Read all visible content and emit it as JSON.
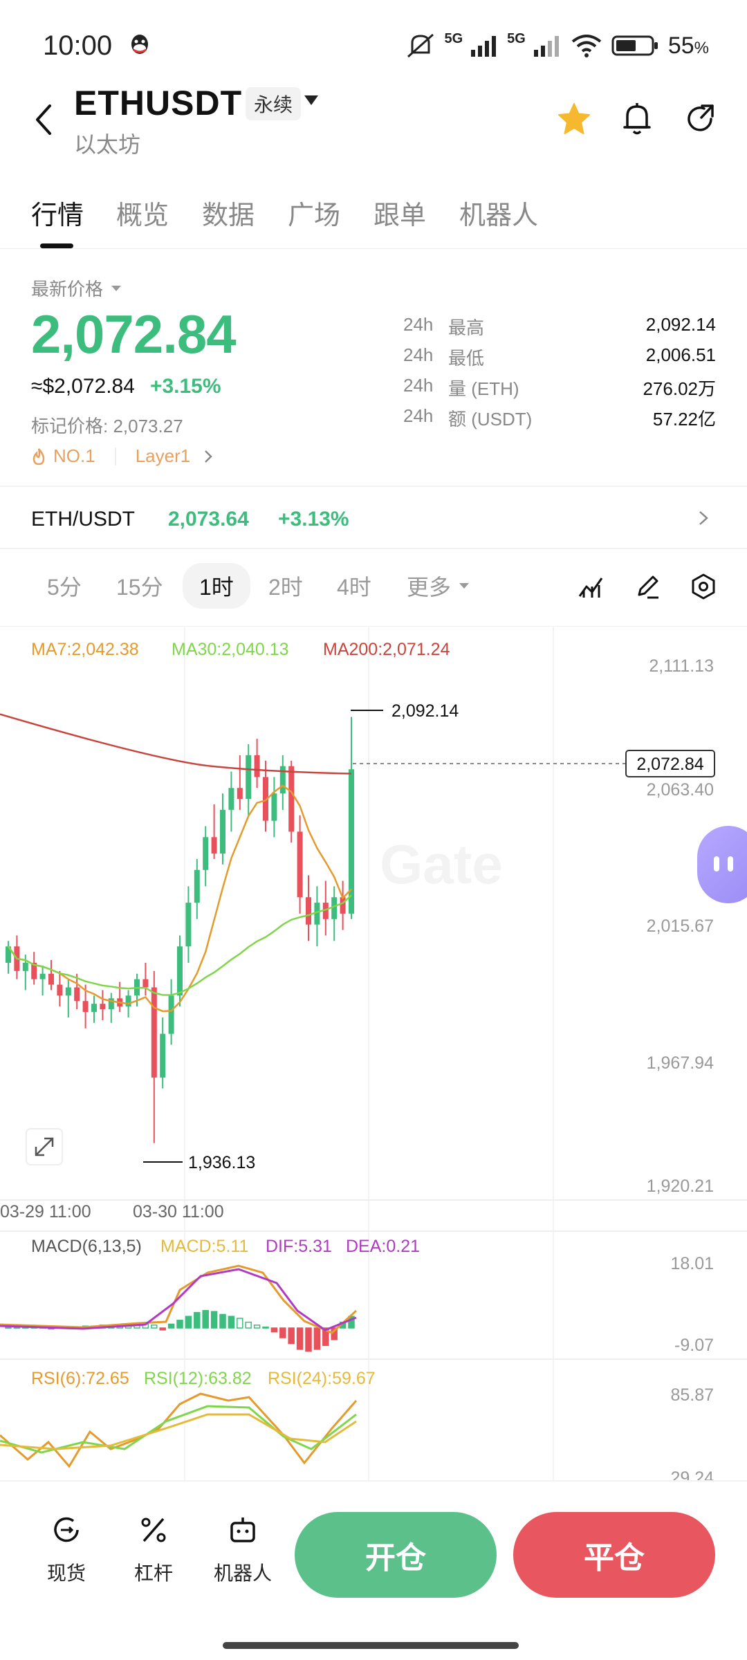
{
  "status_bar": {
    "time": "10:00",
    "signal1": "5G",
    "signal2": "5G",
    "battery": "55",
    "battery_unit": "%"
  },
  "header": {
    "symbol": "ETHUSDT",
    "contract_type": "永续",
    "name_cn": "以太坊"
  },
  "tabs": [
    {
      "label": "行情"
    },
    {
      "label": "概览"
    },
    {
      "label": "数据"
    },
    {
      "label": "广场"
    },
    {
      "label": "跟单"
    },
    {
      "label": "机器人"
    }
  ],
  "price": {
    "latest_label": "最新价格",
    "last": "2,072.84",
    "usd": "≈$2,072.84",
    "change": "+3.15%",
    "mark_label": "标记价格: 2,073.27",
    "tag_rank": "NO.1",
    "tag_sector": "Layer1"
  },
  "stats": [
    {
      "k": "24h",
      "l": "最高",
      "v": "2,092.14"
    },
    {
      "k": "24h",
      "l": "最低",
      "v": "2,006.51"
    },
    {
      "k": "24h",
      "l": "量 (ETH)",
      "v": "276.02万"
    },
    {
      "k": "24h",
      "l": "额 (USDT)",
      "v": "57.22亿"
    }
  ],
  "spot": {
    "pair": "ETH/USDT",
    "price": "2,073.64",
    "change": "+3.13%"
  },
  "timeframes": [
    {
      "label": "5分"
    },
    {
      "label": "15分"
    },
    {
      "label": "1时"
    },
    {
      "label": "2时"
    },
    {
      "label": "4时"
    },
    {
      "label": "更多"
    }
  ],
  "chart_data": {
    "type": "candlestick",
    "ma": {
      "ma7": "MA7:2,042.38",
      "ma30": "MA30:2,040.13",
      "ma200": "MA200:2,071.24"
    },
    "y_ticks": [
      "2,111.13",
      "2,063.40",
      "2,015.67",
      "1,967.94",
      "1,920.21"
    ],
    "ylim": [
      1920.21,
      2111.13
    ],
    "x_ticks": [
      "03-29 11:00",
      "03-30 11:00"
    ],
    "high_label": "2,092.14",
    "low_label": "1,936.13",
    "last_price_label": "2,072.84",
    "watermark": "Gate",
    "candles": [
      [
        2002,
        2010,
        1998,
        2008
      ],
      [
        2008,
        2012,
        1996,
        1999
      ],
      [
        1999,
        2005,
        1992,
        2002
      ],
      [
        2002,
        2006,
        1994,
        1996
      ],
      [
        1996,
        2001,
        1990,
        1998
      ],
      [
        1998,
        2003,
        1992,
        1994
      ],
      [
        1994,
        1999,
        1986,
        1990
      ],
      [
        1990,
        1996,
        1982,
        1993
      ],
      [
        1993,
        1998,
        1985,
        1988
      ],
      [
        1988,
        1994,
        1978,
        1984
      ],
      [
        1984,
        1990,
        1980,
        1987
      ],
      [
        1987,
        1992,
        1981,
        1985
      ],
      [
        1985,
        1991,
        1980,
        1989
      ],
      [
        1989,
        1995,
        1984,
        1986
      ],
      [
        1986,
        1992,
        1982,
        1990
      ],
      [
        1990,
        1998,
        1986,
        1996
      ],
      [
        1996,
        2002,
        1990,
        1993
      ],
      [
        1993,
        1999,
        1936,
        1960
      ],
      [
        1960,
        1982,
        1956,
        1976
      ],
      [
        1976,
        1996,
        1972,
        1990
      ],
      [
        1990,
        2012,
        1986,
        2008
      ],
      [
        2008,
        2030,
        2002,
        2024
      ],
      [
        2024,
        2040,
        2018,
        2036
      ],
      [
        2036,
        2052,
        2030,
        2048
      ],
      [
        2048,
        2060,
        2040,
        2042
      ],
      [
        2042,
        2064,
        2038,
        2058
      ],
      [
        2058,
        2072,
        2050,
        2066
      ],
      [
        2066,
        2078,
        2058,
        2062
      ],
      [
        2062,
        2082,
        2056,
        2078
      ],
      [
        2078,
        2084,
        2066,
        2070
      ],
      [
        2070,
        2076,
        2050,
        2054
      ],
      [
        2054,
        2070,
        2048,
        2064
      ],
      [
        2064,
        2078,
        2058,
        2074
      ],
      [
        2074,
        2076,
        2046,
        2050
      ],
      [
        2050,
        2056,
        2020,
        2026
      ],
      [
        2026,
        2034,
        2010,
        2016
      ],
      [
        2016,
        2030,
        2008,
        2024
      ],
      [
        2024,
        2032,
        2012,
        2018
      ],
      [
        2018,
        2030,
        2010,
        2026
      ],
      [
        2026,
        2032,
        2014,
        2020
      ],
      [
        2020,
        2092,
        2018,
        2072.84
      ]
    ],
    "macd": {
      "label": "MACD(6,13,5)",
      "macd": "MACD:5.11",
      "dif": "DIF:5.31",
      "dea": "DEA:0.21",
      "y_ticks": [
        "18.01",
        "-9.07"
      ]
    },
    "rsi": {
      "rsi6": "RSI(6):72.65",
      "rsi12": "RSI(12):63.82",
      "rsi24": "RSI(24):59.67",
      "y_ticks": [
        "85.87",
        "29.24"
      ]
    }
  },
  "colors": {
    "up": "#3dbd7d",
    "down": "#e8505b",
    "ma7": "#e59a2c",
    "ma30": "#7fd64a",
    "ma200": "#c8453e",
    "macd_dif": "#e59a2c",
    "macd_dea": "#b03ac2"
  },
  "bottom_nav": [
    {
      "label": "现货"
    },
    {
      "label": "杠杆"
    },
    {
      "label": "机器人"
    }
  ],
  "actions": {
    "open": "开仓",
    "close": "平仓"
  }
}
